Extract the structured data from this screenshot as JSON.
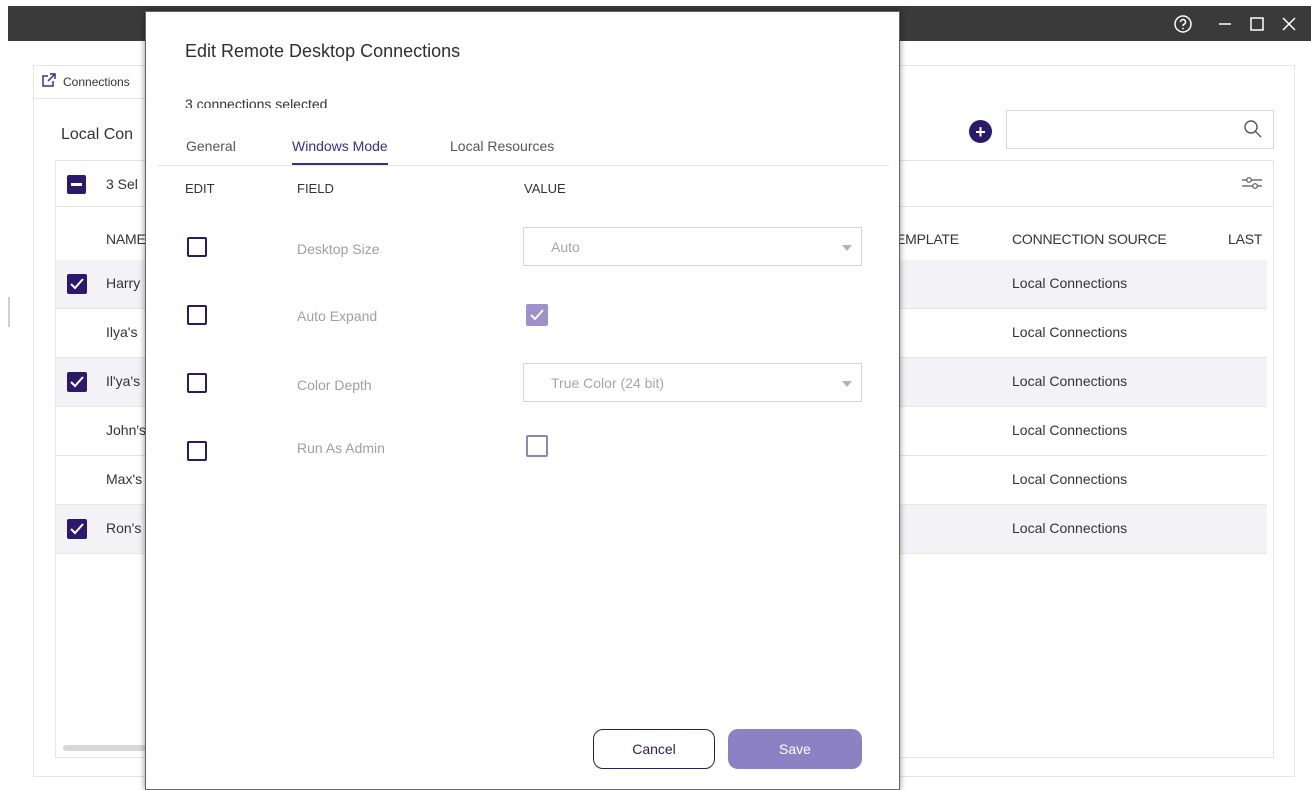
{
  "titlebar": {
    "controls": [
      "help-icon",
      "minimize-icon",
      "maximize-icon",
      "close-icon"
    ]
  },
  "background": {
    "tab_label": "Connections",
    "section_title": "Local Con",
    "selected_count": "3 Sel",
    "columns": {
      "name": "NAME",
      "template": "EMPLATE",
      "source": "CONNECTION SOURCE",
      "last": "LAST"
    },
    "rows": [
      {
        "name": "Harry",
        "source": "Local Connections",
        "selected": true
      },
      {
        "name": "Ilya's",
        "source": "Local Connections",
        "selected": false
      },
      {
        "name": "Il'ya's",
        "source": "Local Connections",
        "selected": true
      },
      {
        "name": "John's",
        "source": "Local Connections",
        "selected": false
      },
      {
        "name": "Max's",
        "source": "Local Connections",
        "selected": false
      },
      {
        "name": "Ron's",
        "source": "Local Connections",
        "selected": true
      }
    ]
  },
  "modal": {
    "title": "Edit Remote Desktop Connections",
    "subtitle": "3 connections selected",
    "tabs": [
      {
        "label": "General",
        "active": false
      },
      {
        "label": "Windows Mode",
        "active": true
      },
      {
        "label": "Local Resources",
        "active": false
      }
    ],
    "headers": {
      "edit": "EDIT",
      "field": "FIELD",
      "value": "VALUE"
    },
    "fields": [
      {
        "label": "Desktop Size",
        "edit": false,
        "type": "select",
        "value": "Auto"
      },
      {
        "label": "Auto Expand",
        "edit": false,
        "type": "checkbox",
        "value": true
      },
      {
        "label": "Color Depth",
        "edit": false,
        "type": "select",
        "value": "True Color (24 bit)"
      },
      {
        "label": "Run As Admin",
        "edit": false,
        "type": "checkbox",
        "value": false
      }
    ],
    "cancel_label": "Cancel",
    "save_label": "Save"
  },
  "colors": {
    "accent": "#2b1a6b",
    "accent_tab": "#3b2d8f",
    "save_button": "#8c82c3",
    "selected_row": "#f3f2f7",
    "titlebar": "#3a3a3a"
  }
}
